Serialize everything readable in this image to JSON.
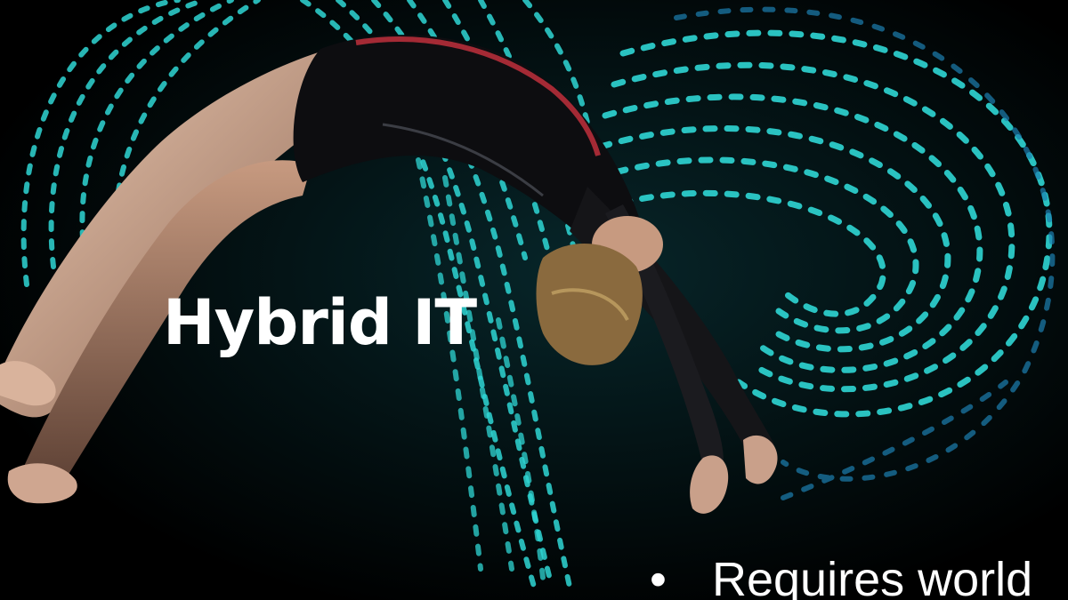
{
  "slide": {
    "title": "Hybrid IT",
    "bullet": {
      "marker": "•",
      "text": "Requires world"
    }
  },
  "colors": {
    "background": "#000000",
    "accent_light_trails": "#2fd6d4",
    "text": "#ffffff",
    "leotard_stripe": "#c0303c"
  },
  "icons": {
    "background": "gymnast-backflip-with-light-trails-photo"
  }
}
